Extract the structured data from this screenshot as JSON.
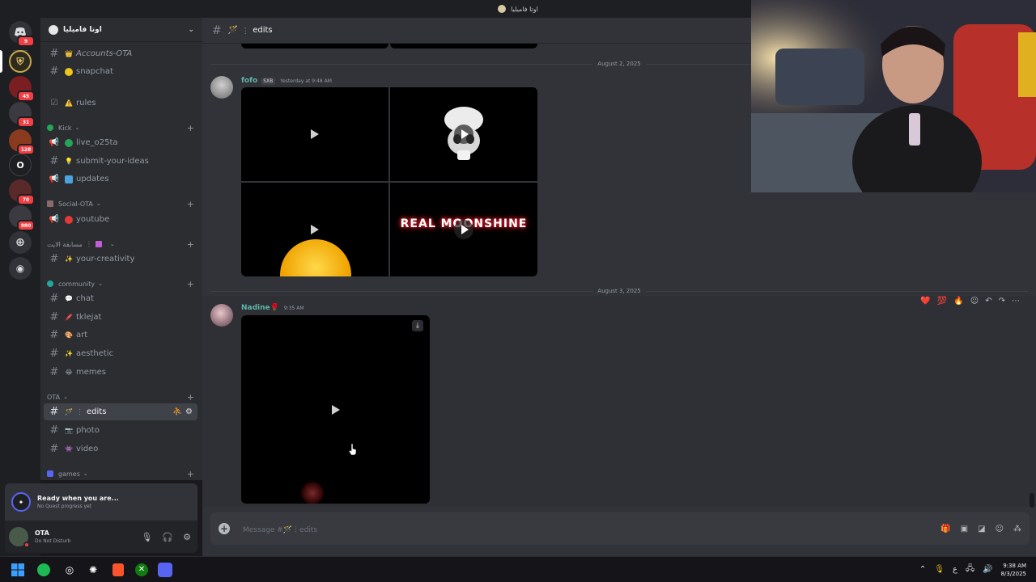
{
  "window": {
    "title": "اوتا فاميليا"
  },
  "rail": {
    "badges": [
      "9",
      "45",
      "31",
      "128",
      "70",
      "980"
    ],
    "text_server": "O"
  },
  "server": {
    "name": "اوتا فاميليا"
  },
  "channels": [
    {
      "id": "accounts",
      "label": "Accounts-OTA",
      "type": "text",
      "emoji": "👑"
    },
    {
      "id": "snapchat",
      "label": "snapchat",
      "type": "text",
      "emoji": "🟡"
    },
    {
      "id": "rules",
      "label": "rules",
      "type": "rules",
      "emoji": "⚠️"
    },
    {
      "id": "live",
      "label": "live_o25ta",
      "type": "announce",
      "emoji": "🟢"
    },
    {
      "id": "ideas",
      "label": "submit-your-ideas",
      "type": "text",
      "emoji": "💡"
    },
    {
      "id": "updates",
      "label": "updates",
      "type": "announce",
      "emoji": "🟦"
    },
    {
      "id": "youtube",
      "label": "youtube",
      "type": "announce",
      "emoji": "🔴"
    },
    {
      "id": "creativity",
      "label": "your-creativity",
      "type": "text",
      "emoji": "✨"
    },
    {
      "id": "chat",
      "label": "chat",
      "type": "text",
      "emoji": "💬"
    },
    {
      "id": "tklejat",
      "label": "tklejat",
      "type": "text",
      "emoji": "🖍️"
    },
    {
      "id": "art",
      "label": "art",
      "type": "text",
      "emoji": "🎨"
    },
    {
      "id": "aesthetic",
      "label": "aesthetic",
      "type": "text",
      "emoji": "✨"
    },
    {
      "id": "memes",
      "label": "memes",
      "type": "text",
      "emoji": "😂"
    },
    {
      "id": "edits",
      "label": "edits",
      "type": "text",
      "emoji": "🪄"
    },
    {
      "id": "photo",
      "label": "photo",
      "type": "text",
      "emoji": "📷"
    },
    {
      "id": "video",
      "label": "video",
      "type": "text",
      "emoji": "👾"
    }
  ],
  "categories": [
    {
      "label": "Kick",
      "color": "#23a55a"
    },
    {
      "label": "Social-OTA",
      "color": "#8b6a6a"
    },
    {
      "label": "مسابقة الايت",
      "color": "#c15bd6"
    },
    {
      "label": "community",
      "color": "#23a5a0"
    },
    {
      "label": "OTA",
      "color": ""
    },
    {
      "label": "games",
      "color": "#5865f2"
    }
  ],
  "quest": {
    "title": "Ready when you are...",
    "subtitle": "No Quest progress yet"
  },
  "user": {
    "name": "OTA",
    "status": "Do Not Disturb"
  },
  "main": {
    "channel_title": "edits",
    "date1": "August 2, 2025",
    "msg1": {
      "author": "fofo",
      "tag": "SXB",
      "time": "Yesterday at 9:48 AM"
    },
    "date2": "August 3, 2025",
    "msg2": {
      "author": "Nadine🌹",
      "time": "9:35 AM"
    },
    "reactions": [
      "❤️",
      "💯",
      "🔥"
    ],
    "composer_placeholder": "Message #🪄︙edits"
  },
  "tile_text": "REAL MOONSHINE",
  "taskbar": {
    "time": "9:38 AM",
    "date": "8/3/2025",
    "lang": "ع"
  },
  "colors": {
    "accent": "#5865f2",
    "dnd": "#f23f43",
    "author": "#5fb4a8"
  }
}
